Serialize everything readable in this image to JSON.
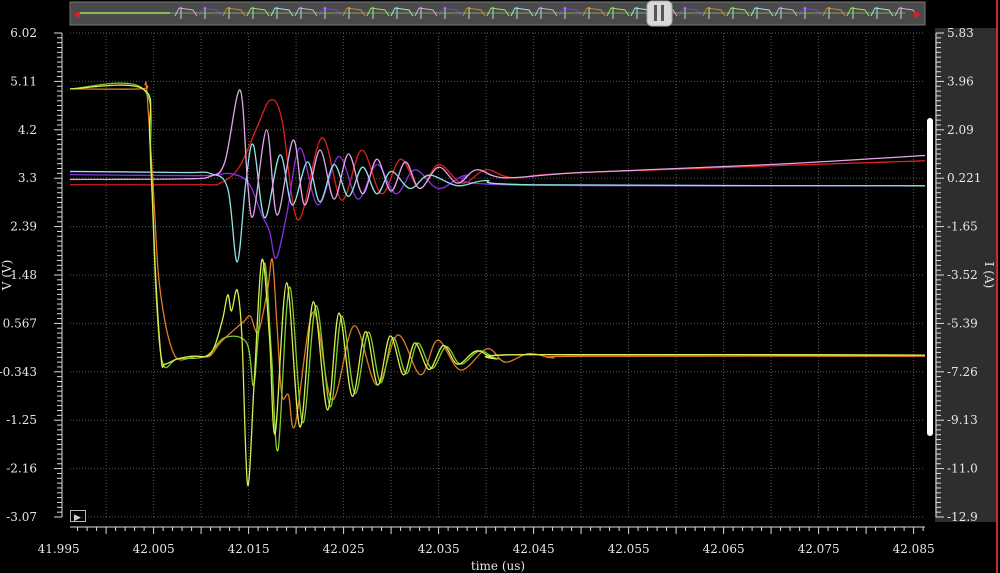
{
  "overview": {
    "left_arrow": "◀",
    "right_arrow": "▶"
  },
  "play_button": "▶",
  "chart_data": {
    "type": "line",
    "title": "",
    "xlabel": "time (us)",
    "ylabel": "V (V)",
    "y2label": "I (A)",
    "xlim": [
      41.9962,
      42.0862
    ],
    "ylim": [
      -3.07,
      6.02
    ],
    "y2lim": [
      -12.9,
      5.83
    ],
    "grid": true,
    "x_ticks": [
      "41.995",
      "42.005",
      "42.015",
      "42.025",
      "42.035",
      "42.045",
      "42.055",
      "42.065",
      "42.075",
      "42.085"
    ],
    "y_ticks": [
      "6.02",
      "5.11",
      "4.2",
      "3.3",
      "2.39",
      "1.48",
      "0.567",
      "-0.343",
      "-1.25",
      "-2.16",
      "-3.07"
    ],
    "y2_ticks": [
      "5.83",
      "3.96",
      "2.09",
      "0.221",
      "-1.65",
      "-3.52",
      "-5.39",
      "-7.26",
      "-9.13",
      "-11.0",
      "-12.9"
    ],
    "series": [
      {
        "name": "red",
        "color": "#e0201c",
        "points": [
          [
            41.9962,
            3.17
          ],
          [
            42.01,
            3.17
          ],
          [
            42.012,
            3.2
          ],
          [
            42.014,
            3.5
          ],
          [
            42.016,
            4.3
          ],
          [
            42.0173,
            4.76
          ],
          [
            42.0185,
            4.4
          ],
          [
            42.0202,
            2.51
          ],
          [
            42.0227,
            4.05
          ],
          [
            42.0248,
            2.88
          ],
          [
            42.0269,
            3.82
          ],
          [
            42.029,
            3.0
          ],
          [
            42.031,
            3.65
          ],
          [
            42.033,
            3.1
          ],
          [
            42.035,
            3.55
          ],
          [
            42.0375,
            3.2
          ],
          [
            42.04,
            3.45
          ],
          [
            42.043,
            3.3
          ],
          [
            42.05,
            3.4
          ],
          [
            42.0862,
            3.62
          ]
        ]
      },
      {
        "name": "purple",
        "color": "#8a30e0",
        "points": [
          [
            41.9962,
            3.36
          ],
          [
            42.01,
            3.34
          ],
          [
            42.013,
            3.38
          ],
          [
            42.015,
            3.2
          ],
          [
            42.0164,
            2.6
          ],
          [
            42.0172,
            2.3
          ],
          [
            42.0179,
            1.79
          ],
          [
            42.019,
            2.6
          ],
          [
            42.0204,
            3.86
          ],
          [
            42.0223,
            2.79
          ],
          [
            42.0245,
            3.7
          ],
          [
            42.0265,
            2.9
          ],
          [
            42.0285,
            3.55
          ],
          [
            42.0305,
            3.0
          ],
          [
            42.0325,
            3.45
          ],
          [
            42.035,
            3.1
          ],
          [
            42.038,
            3.35
          ],
          [
            42.042,
            3.17
          ],
          [
            42.0862,
            3.15
          ]
        ]
      },
      {
        "name": "cyan",
        "color": "#90e4e4",
        "points": [
          [
            41.9962,
            3.42
          ],
          [
            42.008,
            3.4
          ],
          [
            42.011,
            3.38
          ],
          [
            42.0128,
            3.1
          ],
          [
            42.0138,
            1.72
          ],
          [
            42.0147,
            3.2
          ],
          [
            42.0155,
            3.92
          ],
          [
            42.0167,
            2.55
          ],
          [
            42.0183,
            3.73
          ],
          [
            42.0196,
            2.79
          ],
          [
            42.0212,
            3.6
          ],
          [
            42.0225,
            2.85
          ],
          [
            42.024,
            3.55
          ],
          [
            42.0255,
            2.95
          ],
          [
            42.027,
            3.5
          ],
          [
            42.0285,
            3.0
          ],
          [
            42.03,
            3.42
          ],
          [
            42.032,
            3.1
          ],
          [
            42.034,
            3.35
          ],
          [
            42.037,
            3.15
          ],
          [
            42.04,
            3.25
          ],
          [
            42.045,
            3.17
          ],
          [
            42.0862,
            3.15
          ]
        ]
      },
      {
        "name": "pink",
        "color": "#e4a4ec",
        "points": [
          [
            41.9962,
            3.27
          ],
          [
            42.008,
            3.28
          ],
          [
            42.011,
            3.33
          ],
          [
            42.0125,
            3.6
          ],
          [
            42.0141,
            4.95
          ],
          [
            42.0149,
            3.2
          ],
          [
            42.0155,
            2.6
          ],
          [
            42.0169,
            4.2
          ],
          [
            42.018,
            2.6
          ],
          [
            42.0197,
            4.01
          ],
          [
            42.0209,
            2.79
          ],
          [
            42.0225,
            3.82
          ],
          [
            42.024,
            2.9
          ],
          [
            42.0255,
            3.75
          ],
          [
            42.027,
            3.0
          ],
          [
            42.0285,
            3.65
          ],
          [
            42.03,
            3.05
          ],
          [
            42.0315,
            3.6
          ],
          [
            42.033,
            3.1
          ],
          [
            42.035,
            3.5
          ],
          [
            42.037,
            3.2
          ],
          [
            42.039,
            3.45
          ],
          [
            42.042,
            3.3
          ],
          [
            42.05,
            3.4
          ],
          [
            42.07,
            3.55
          ],
          [
            42.0862,
            3.72
          ]
        ]
      },
      {
        "name": "orange",
        "color": "#e07a2a",
        "points": [
          [
            41.9962,
            4.97
          ],
          [
            42.0037,
            4.97
          ],
          [
            42.0041,
            5.05
          ],
          [
            42.0043,
            4.9
          ],
          [
            42.005,
            3.0
          ],
          [
            42.0055,
            1.5
          ],
          [
            42.0062,
            0.6
          ],
          [
            42.007,
            0.05
          ],
          [
            42.0078,
            -0.12
          ],
          [
            42.0095,
            -0.05
          ],
          [
            42.0109,
            -0.05
          ],
          [
            42.012,
            0.2
          ],
          [
            42.0135,
            0.45
          ],
          [
            42.0145,
            0.6
          ],
          [
            42.0152,
            0.7
          ],
          [
            42.016,
            0.4
          ],
          [
            42.017,
            1.2
          ],
          [
            42.0175,
            1.76
          ],
          [
            42.018,
            0.5
          ],
          [
            42.0185,
            -0.78
          ],
          [
            42.0192,
            -0.78
          ],
          [
            42.0199,
            -1.34
          ],
          [
            42.0218,
            0.78
          ],
          [
            42.0238,
            -0.87
          ],
          [
            42.0261,
            0.52
          ],
          [
            42.0285,
            -0.59
          ],
          [
            42.0307,
            0.35
          ],
          [
            42.0331,
            -0.4
          ],
          [
            42.0349,
            0.25
          ],
          [
            42.0373,
            -0.31
          ],
          [
            42.0401,
            0.09
          ],
          [
            42.042,
            -0.16
          ],
          [
            42.0445,
            0.0
          ],
          [
            42.047,
            -0.08
          ],
          [
            42.05,
            -0.05
          ],
          [
            42.0862,
            -0.05
          ]
        ]
      },
      {
        "name": "green",
        "color": "#7fcf2a",
        "points": [
          [
            41.9962,
            4.97
          ],
          [
            42.0039,
            4.97
          ],
          [
            42.0047,
            3.5
          ],
          [
            42.0053,
            1.0
          ],
          [
            42.006,
            -0.2
          ],
          [
            42.0075,
            -0.1
          ],
          [
            42.0105,
            -0.05
          ],
          [
            42.0125,
            0.3
          ],
          [
            42.0148,
            0.2
          ],
          [
            42.0155,
            -0.6
          ],
          [
            42.016,
            0.3
          ],
          [
            42.0167,
            1.7
          ],
          [
            42.0174,
            0.0
          ],
          [
            42.0181,
            -1.81
          ],
          [
            42.0193,
            1.25
          ],
          [
            42.0207,
            -1.3
          ],
          [
            42.0221,
            0.9
          ],
          [
            42.0236,
            -1.0
          ],
          [
            42.0248,
            0.7
          ],
          [
            42.0262,
            -0.75
          ],
          [
            42.0276,
            0.4
          ],
          [
            42.0289,
            -0.55
          ],
          [
            42.0302,
            0.3
          ],
          [
            42.0316,
            -0.38
          ],
          [
            42.0328,
            0.2
          ],
          [
            42.0343,
            -0.28
          ],
          [
            42.0358,
            0.13
          ],
          [
            42.0373,
            -0.2
          ],
          [
            42.0393,
            0.05
          ],
          [
            42.0413,
            -0.1
          ],
          [
            42.0443,
            -0.02
          ],
          [
            42.0862,
            -0.03
          ]
        ]
      },
      {
        "name": "yellow",
        "color": "#dcec50",
        "points": [
          [
            41.9962,
            4.97
          ],
          [
            42.0039,
            4.97
          ],
          [
            42.0046,
            4.0
          ],
          [
            42.0052,
            1.5
          ],
          [
            42.0058,
            -0.1
          ],
          [
            42.0062,
            -0.2
          ],
          [
            42.0075,
            -0.1
          ],
          [
            42.009,
            -0.05
          ],
          [
            42.011,
            0.0
          ],
          [
            42.0122,
            0.6
          ],
          [
            42.0128,
            1.1
          ],
          [
            42.0132,
            0.8
          ],
          [
            42.0138,
            1.19
          ],
          [
            42.0143,
            0.3
          ],
          [
            42.0149,
            -2.47
          ],
          [
            42.0156,
            -0.5
          ],
          [
            42.0164,
            1.76
          ],
          [
            42.0172,
            0.3
          ],
          [
            42.0178,
            -1.5
          ],
          [
            42.019,
            1.33
          ],
          [
            42.0204,
            -1.38
          ],
          [
            42.0218,
            0.97
          ],
          [
            42.0233,
            -1.06
          ],
          [
            42.0245,
            0.76
          ],
          [
            42.0259,
            -0.8
          ],
          [
            42.0273,
            0.41
          ],
          [
            42.0286,
            -0.59
          ],
          [
            42.0299,
            0.33
          ],
          [
            42.0313,
            -0.4
          ],
          [
            42.0325,
            0.2
          ],
          [
            42.034,
            -0.3
          ],
          [
            42.0355,
            0.15
          ],
          [
            42.037,
            -0.2
          ],
          [
            42.039,
            0.05
          ],
          [
            42.041,
            -0.1
          ],
          [
            42.044,
            -0.02
          ],
          [
            42.0862,
            -0.03
          ]
        ]
      }
    ]
  }
}
